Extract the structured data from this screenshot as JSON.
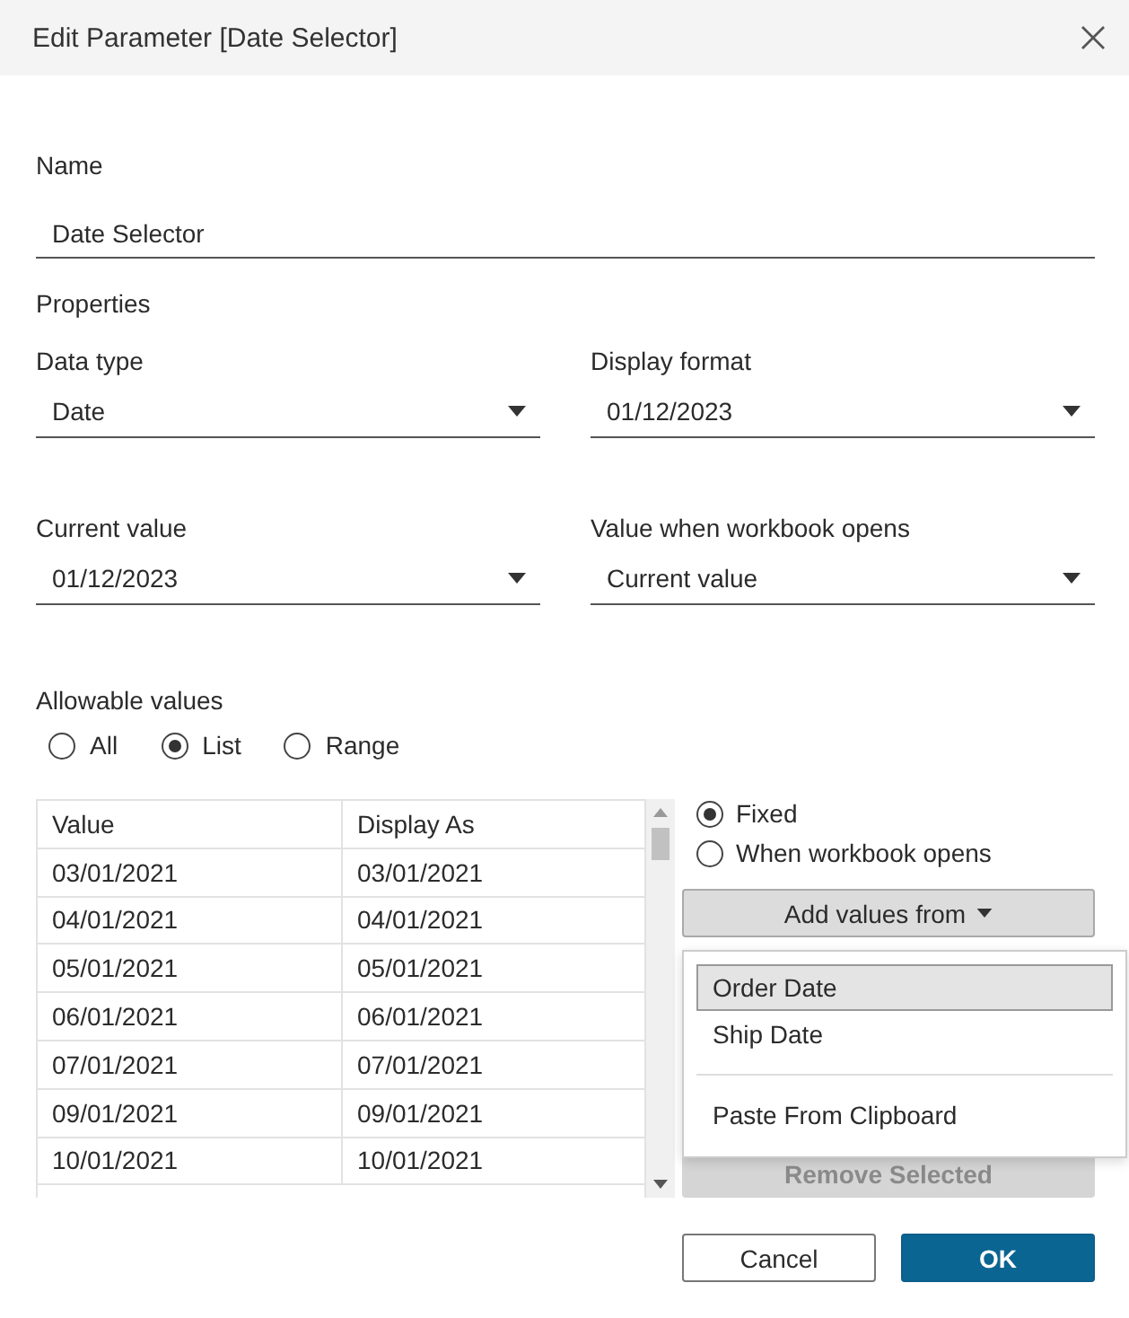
{
  "window": {
    "title": "Edit Parameter [Date Selector]"
  },
  "name": {
    "label": "Name",
    "value": "Date Selector"
  },
  "properties": {
    "heading": "Properties",
    "fields": [
      {
        "label": "Data type",
        "value": "Date"
      },
      {
        "label": "Display format",
        "value": "01/12/2023"
      },
      {
        "label": "Current value",
        "value": "01/12/2023"
      },
      {
        "label": "Value when workbook opens",
        "value": "Current value"
      }
    ]
  },
  "allowable_values": {
    "label": "Allowable values",
    "options": [
      {
        "label": "All",
        "selected": false
      },
      {
        "label": "List",
        "selected": true
      },
      {
        "label": "Range",
        "selected": false
      }
    ]
  },
  "table": {
    "columns": [
      "Value",
      "Display As"
    ],
    "rows": [
      [
        "03/01/2021",
        "03/01/2021"
      ],
      [
        "04/01/2021",
        "04/01/2021"
      ],
      [
        "05/01/2021",
        "05/01/2021"
      ],
      [
        "06/01/2021",
        "06/01/2021"
      ],
      [
        "07/01/2021",
        "07/01/2021"
      ],
      [
        "09/01/2021",
        "09/01/2021"
      ],
      [
        "10/01/2021",
        "10/01/2021"
      ]
    ]
  },
  "list_source": {
    "options": [
      {
        "label": "Fixed",
        "selected": true
      },
      {
        "label": "When workbook opens",
        "selected": false
      }
    ]
  },
  "add_values_button": {
    "label": "Add values from"
  },
  "add_values_menu": {
    "items": [
      {
        "label": "Order Date",
        "kind": "item",
        "highlighted": true
      },
      {
        "label": "Ship Date",
        "kind": "item",
        "highlighted": false
      },
      {
        "kind": "separator"
      },
      {
        "label": "Paste From Clipboard",
        "kind": "item",
        "highlighted": false
      }
    ]
  },
  "remove_button": {
    "label": "Remove Selected",
    "disabled": true
  },
  "buttons": [
    {
      "label": "Cancel",
      "kind": "secondary"
    },
    {
      "label": "OK",
      "kind": "primary"
    }
  ]
}
